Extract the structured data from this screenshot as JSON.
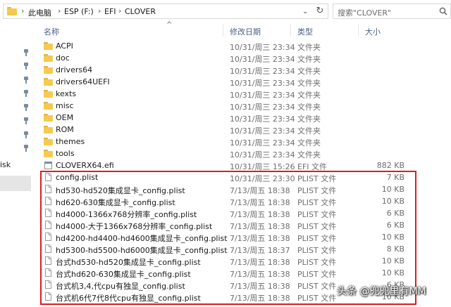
{
  "address_bar": {
    "breadcrumbs": [
      "此电脑",
      "ESP (F:)",
      "EFI",
      "CLOVER"
    ],
    "search_placeholder": "搜索\"CLOVER\""
  },
  "nav_pane": {
    "partial_label": "isk"
  },
  "columns": {
    "name": "名称",
    "date": "修改日期",
    "type": "类型",
    "size": "大小"
  },
  "files": [
    {
      "name": "ACPI",
      "date": "10/31/周三 23:34",
      "type": "文件夹",
      "size": "",
      "icon": "folder-icon"
    },
    {
      "name": "doc",
      "date": "10/31/周三 23:34",
      "type": "文件夹",
      "size": "",
      "icon": "folder-icon"
    },
    {
      "name": "drivers64",
      "date": "10/31/周三 23:34",
      "type": "文件夹",
      "size": "",
      "icon": "folder-icon"
    },
    {
      "name": "drivers64UEFI",
      "date": "10/31/周三 23:34",
      "type": "文件夹",
      "size": "",
      "icon": "folder-icon"
    },
    {
      "name": "kexts",
      "date": "10/31/周三 23:34",
      "type": "文件夹",
      "size": "",
      "icon": "folder-icon"
    },
    {
      "name": "misc",
      "date": "10/31/周三 23:34",
      "type": "文件夹",
      "size": "",
      "icon": "folder-icon"
    },
    {
      "name": "OEM",
      "date": "10/31/周三 23:34",
      "type": "文件夹",
      "size": "",
      "icon": "folder-icon"
    },
    {
      "name": "ROM",
      "date": "10/31/周三 23:34",
      "type": "文件夹",
      "size": "",
      "icon": "folder-icon"
    },
    {
      "name": "themes",
      "date": "10/31/周三 23:34",
      "type": "文件夹",
      "size": "",
      "icon": "folder-icon"
    },
    {
      "name": "tools",
      "date": "10/31/周三 23:34",
      "type": "文件夹",
      "size": "",
      "icon": "folder-icon"
    },
    {
      "name": "CLOVERX64.efi",
      "date": "10/31/周三 15:26",
      "type": "EFI 文件",
      "size": "882 KB",
      "icon": "efi-file-icon"
    },
    {
      "name": "config.plist",
      "date": "10/31/周三 23:30",
      "type": "PLIST 文件",
      "size": "7 KB",
      "icon": "plist-file-icon"
    },
    {
      "name": "hd530-hd520集成显卡_config.plist",
      "date": "7/13/周五 18:38",
      "type": "PLIST 文件",
      "size": "10 KB",
      "icon": "plist-file-icon"
    },
    {
      "name": "hd620-630集成显卡_config.plist",
      "date": "7/13/周五 18:38",
      "type": "PLIST 文件",
      "size": "10 KB",
      "icon": "plist-file-icon"
    },
    {
      "name": "hd4000-1366x768分辨率_config.plist",
      "date": "7/13/周五 18:38",
      "type": "PLIST 文件",
      "size": "6 KB",
      "icon": "plist-file-icon"
    },
    {
      "name": "hd4000-大于1366x768分辨率_config.plist",
      "date": "7/13/周五 18:38",
      "type": "PLIST 文件",
      "size": "6 KB",
      "icon": "plist-file-icon"
    },
    {
      "name": "hd4200-hd4400-hd4600集成显卡_config.plist",
      "date": "7/13/周五 18:38",
      "type": "PLIST 文件",
      "size": "10 KB",
      "icon": "plist-file-icon"
    },
    {
      "name": "hd5300-hd5500-hd6000集成显卡_config.plist",
      "date": "7/13/周五 18:37",
      "type": "PLIST 文件",
      "size": "8 KB",
      "icon": "plist-file-icon"
    },
    {
      "name": "台式hd530-hd520集成显卡_config.plist",
      "date": "7/13/周五 18:38",
      "type": "PLIST 文件",
      "size": "10 KB",
      "icon": "plist-file-icon"
    },
    {
      "name": "台式hd620-630集成显卡_config.plist",
      "date": "7/13/周五 18:38",
      "type": "PLIST 文件",
      "size": "10 KB",
      "icon": "plist-file-icon"
    },
    {
      "name": "台式机3,4,代cpu有独显_config.plist",
      "date": "7/13/周五 18:38",
      "type": "PLIST 文件",
      "size": "6 KB",
      "icon": "plist-file-icon"
    },
    {
      "name": "台式机6代7代8代cpu有独显_config.plist",
      "date": "7/13/周五 18:38",
      "type": "PLIST 文件",
      "size": "10 KB",
      "icon": "plist-file-icon"
    }
  ],
  "watermark": "头条 @兜兜里有MM",
  "colors": {
    "highlight_border": "#e01b1b",
    "column_header_text": "#4d6082",
    "folder_yellow": "#f5ca52"
  }
}
